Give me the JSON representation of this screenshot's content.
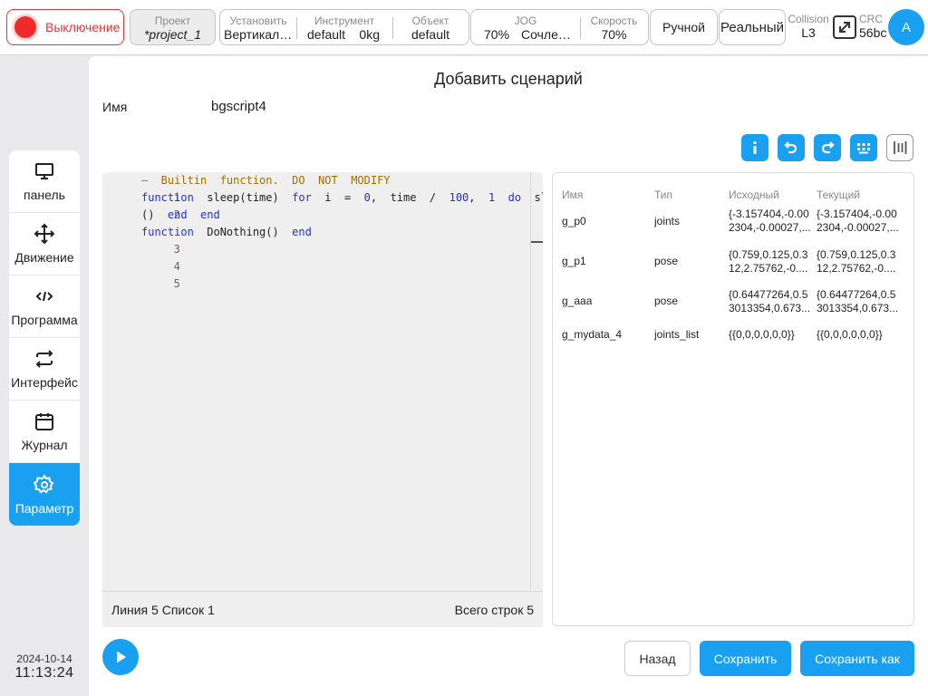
{
  "topbar": {
    "power_label": "Выключение",
    "project": {
      "caption": "Проект",
      "value": "*project_1"
    },
    "install": {
      "caption": "Установить",
      "value": "Вертикальная"
    },
    "tool": {
      "caption": "Инструмент",
      "value": "default",
      "weight": "0kg"
    },
    "object": {
      "caption": "Объект",
      "value": "default"
    },
    "jog": {
      "caption": "JOG",
      "percent": "70%",
      "mode": "Сочленение"
    },
    "speed": {
      "caption": "Скорость",
      "value": "70%"
    },
    "mode": "Ручной",
    "real": "Реальный",
    "collision": {
      "caption": "Collision",
      "value": "L3"
    },
    "crc": {
      "caption": "CRC",
      "value": "56bc"
    },
    "avatar": "A"
  },
  "sidebar": {
    "items": [
      {
        "label": "панель",
        "icon": "monitor-icon"
      },
      {
        "label": "Движение",
        "icon": "move-arrows-icon"
      },
      {
        "label": "Программа",
        "icon": "code-icon"
      },
      {
        "label": "Интерфейс",
        "icon": "swap-arrows-icon"
      },
      {
        "label": "Журнал",
        "icon": "calendar-icon"
      },
      {
        "label": "Параметр",
        "icon": "gear-icon",
        "active": true
      }
    ]
  },
  "datetime": {
    "date": "2024-10-14",
    "time": "11:13:24"
  },
  "page": {
    "title": "Добавить сценарий",
    "name_label": "Имя",
    "name_value": "bgscript4"
  },
  "editor": {
    "line_numbers": [
      "1",
      "2",
      "",
      "3",
      "4",
      "5"
    ],
    "status_left": "Линия 5 Список 1",
    "status_right": "Всего строк 5"
  },
  "variables": {
    "headers": {
      "name": "Имя",
      "type": "Тип",
      "initial": "Исходный",
      "current": "Текущий"
    },
    "rows": [
      {
        "name": "g_p0",
        "type": "joints",
        "initial": "{-3.157404,-0.002304,-0.00027,...",
        "current": "{-3.157404,-0.002304,-0.00027,..."
      },
      {
        "name": "g_p1",
        "type": "pose",
        "initial": "{0.759,0.125,0.312,2.75762,-0....",
        "current": "{0.759,0.125,0.312,2.75762,-0...."
      },
      {
        "name": "g_aaa",
        "type": "pose",
        "initial": "{0.64477264,0.53013354,0.673...",
        "current": "{0.64477264,0.53013354,0.673..."
      },
      {
        "name": "g_mydata_4",
        "type": "joints_list",
        "initial": "{{0,0,0,0,0,0}}",
        "current": "{{0,0,0,0,0,0}}"
      }
    ]
  },
  "buttons": {
    "back": "Назад",
    "save": "Сохранить",
    "save_as": "Сохранить как"
  },
  "colors": {
    "accent": "#1aa0f0",
    "power": "#e8323c"
  }
}
